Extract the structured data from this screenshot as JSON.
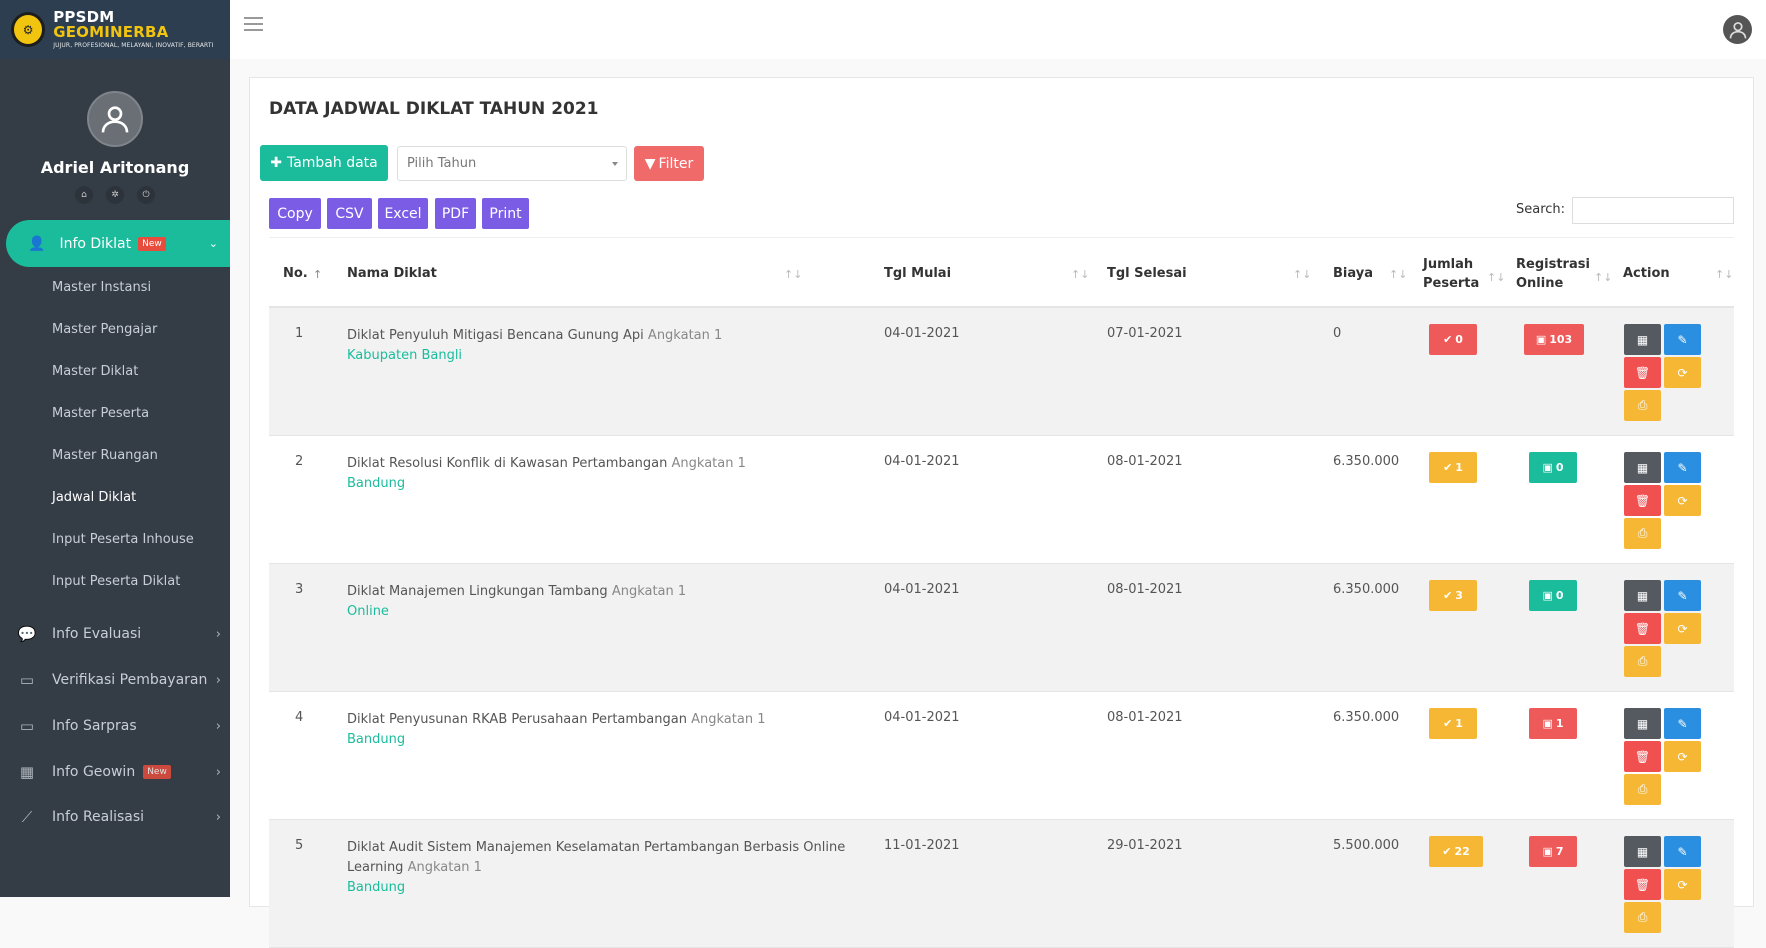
{
  "brand": {
    "name_part1": "PPSDM ",
    "name_part2": "GEOMINERBA",
    "tagline": "JUJUR, PROFESIONAL, MELAYANI, INOVATIF, BERARTI"
  },
  "user": {
    "name": "Adriel Aritonang"
  },
  "sidebar": {
    "active": {
      "label": "Info Diklat",
      "badge": "New"
    },
    "submenu": [
      "Master Instansi",
      "Master Pengajar",
      "Master Diklat",
      "Master Peserta",
      "Master Ruangan",
      "Jadwal Diklat",
      "Input Peserta Inhouse",
      "Input Peserta Diklat"
    ],
    "menu": [
      {
        "label": "Info Evaluasi",
        "icon": "comments-icon"
      },
      {
        "label": "Verifikasi Pembayaran",
        "icon": "money-icon"
      },
      {
        "label": "Info Sarpras",
        "icon": "desktop-icon"
      },
      {
        "label": "Info Geowin",
        "icon": "building-icon",
        "badge": "New"
      },
      {
        "label": "Info Realisasi",
        "icon": "chart-line-icon"
      }
    ]
  },
  "page": {
    "title": "DATA JADWAL DIKLAT TAHUN 2021",
    "add_label": "Tambah data",
    "year_placeholder": "Pilih Tahun",
    "filter_label": "Filter",
    "export_buttons": [
      "Copy",
      "CSV",
      "Excel",
      "PDF",
      "Print"
    ],
    "search_label": "Search:"
  },
  "table": {
    "headers": {
      "no": "No.",
      "nama": "Nama Diklat",
      "mulai": "Tgl Mulai",
      "selesai": "Tgl Selesai",
      "biaya": "Biaya",
      "jumlah_line1": "Jumlah",
      "jumlah_line2": "Peserta",
      "reg_line1": "Registrasi",
      "reg_line2": "Online",
      "action": "Action"
    },
    "rows": [
      {
        "no": "1",
        "nama": "Diklat Penyuluh Mitigasi Bencana Gunung Api",
        "angkatan": "Angkatan 1",
        "lokasi": "Kabupaten Bangli",
        "mulai": "04-01-2021",
        "selesai": "07-01-2021",
        "biaya": "0",
        "jumlah": "0",
        "jumlah_color": "red",
        "reg": "103",
        "reg_color": "red"
      },
      {
        "no": "2",
        "nama": "Diklat Resolusi Konflik di Kawasan Pertambangan",
        "angkatan": "Angkatan 1",
        "lokasi": "Bandung",
        "mulai": "04-01-2021",
        "selesai": "08-01-2021",
        "biaya": "6.350.000",
        "jumlah": "1",
        "jumlah_color": "yellow",
        "reg": "0",
        "reg_color": "green"
      },
      {
        "no": "3",
        "nama": "Diklat Manajemen Lingkungan Tambang",
        "angkatan": "Angkatan 1",
        "lokasi": "Online",
        "mulai": "04-01-2021",
        "selesai": "08-01-2021",
        "biaya": "6.350.000",
        "jumlah": "3",
        "jumlah_color": "yellow",
        "reg": "0",
        "reg_color": "green"
      },
      {
        "no": "4",
        "nama": "Diklat Penyusunan RKAB Perusahaan Pertambangan",
        "angkatan": "Angkatan 1",
        "lokasi": "Bandung",
        "mulai": "04-01-2021",
        "selesai": "08-01-2021",
        "biaya": "6.350.000",
        "jumlah": "1",
        "jumlah_color": "yellow",
        "reg": "1",
        "reg_color": "red"
      },
      {
        "no": "5",
        "nama": "Diklat Audit Sistem Manajemen Keselamatan Pertambangan Berbasis Online Learning",
        "angkatan": "Angkatan 1",
        "lokasi": "Bandung",
        "mulai": "11-01-2021",
        "selesai": "29-01-2021",
        "biaya": "5.500.000",
        "jumlah": "22",
        "jumlah_color": "yellow",
        "reg": "7",
        "reg_color": "red"
      }
    ]
  }
}
